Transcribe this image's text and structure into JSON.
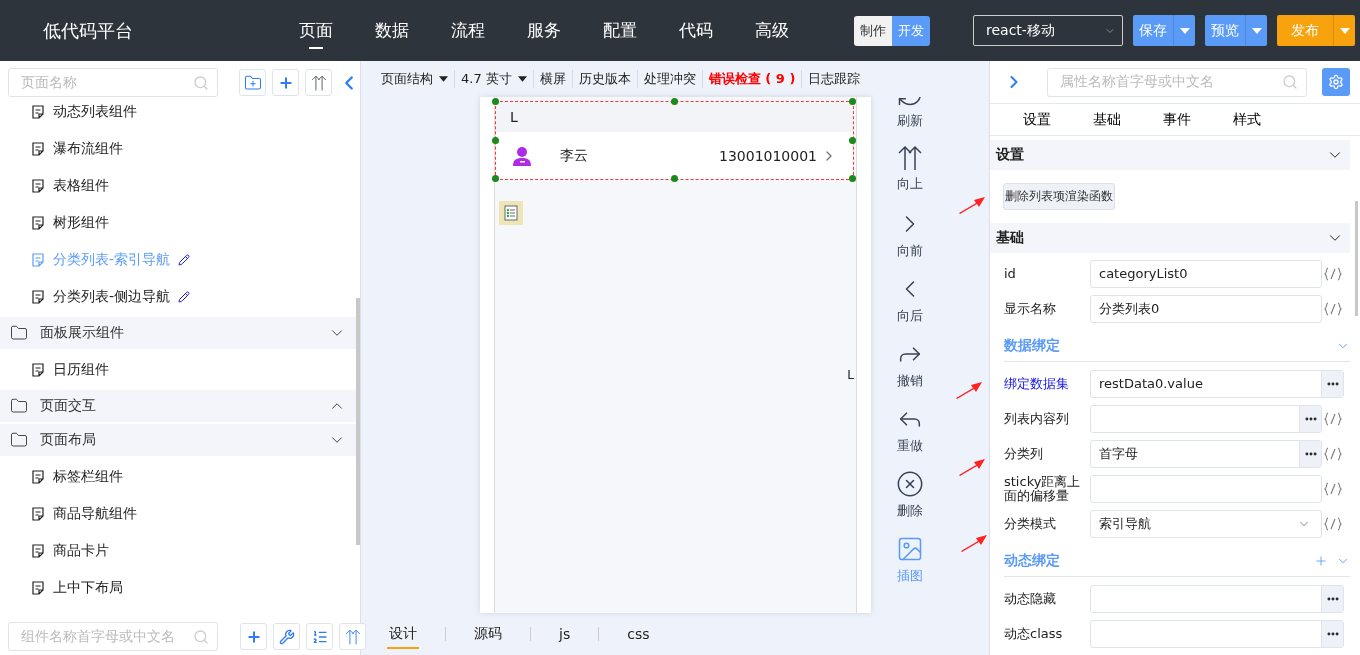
{
  "app": {
    "title": "低代码平台"
  },
  "nav": [
    {
      "label": "页面",
      "selected": true
    },
    {
      "label": "数据",
      "selected": false
    },
    {
      "label": "流程",
      "selected": false
    },
    {
      "label": "服务",
      "selected": false
    },
    {
      "label": "配置",
      "selected": false
    },
    {
      "label": "代码",
      "selected": false
    },
    {
      "label": "高级",
      "selected": false
    }
  ],
  "mode_toggle": [
    {
      "label": "制作",
      "selected": false
    },
    {
      "label": "开发",
      "selected": true
    }
  ],
  "framework_select": {
    "value": "react-移动"
  },
  "actions": [
    {
      "label": "保存",
      "kind": "primary"
    },
    {
      "label": "预览",
      "kind": "primary"
    },
    {
      "label": "发布",
      "kind": "publish"
    }
  ],
  "page_tree": {
    "search": {
      "placeholder": "页面名称"
    },
    "items": [
      {
        "kind": "page",
        "label": "动态列表组件",
        "selected": false,
        "editable": false
      },
      {
        "kind": "page",
        "label": "瀑布流组件",
        "selected": false,
        "editable": false
      },
      {
        "kind": "page",
        "label": "表格组件",
        "selected": false,
        "editable": false
      },
      {
        "kind": "page",
        "label": "树形组件",
        "selected": false,
        "editable": false
      },
      {
        "kind": "page",
        "label": "分类列表-索引导航",
        "selected": true,
        "editable": true
      },
      {
        "kind": "page",
        "label": "分类列表-侧边导航",
        "selected": false,
        "editable": true
      },
      {
        "kind": "group",
        "label": "面板展示组件",
        "expanded": true,
        "children": [
          {
            "kind": "page",
            "label": "日历组件",
            "selected": false,
            "editable": false
          }
        ]
      },
      {
        "kind": "group",
        "label": "页面交互",
        "expanded": false
      },
      {
        "kind": "group",
        "label": "页面布局",
        "expanded": true,
        "children": [
          {
            "kind": "page",
            "label": "标签栏组件",
            "selected": false,
            "editable": false
          },
          {
            "kind": "page",
            "label": "商品导航组件",
            "selected": false,
            "editable": false
          },
          {
            "kind": "page",
            "label": "商品卡片",
            "selected": false,
            "editable": false
          },
          {
            "kind": "page",
            "label": "上中下布局",
            "selected": false,
            "editable": false
          }
        ]
      }
    ]
  },
  "component_search": {
    "placeholder": "组件名称首字母或中文名"
  },
  "canvas_toolbar": [
    {
      "label": "页面结构",
      "kind": "dropdown"
    },
    {
      "label": "4.7 英寸",
      "kind": "dropdown"
    },
    {
      "label": "横屏",
      "kind": "plain"
    },
    {
      "label": "历史版本",
      "kind": "plain"
    },
    {
      "label": "处理冲突",
      "kind": "plain"
    },
    {
      "label": "错误检查 ( 9 )",
      "kind": "error"
    },
    {
      "label": "日志跟踪",
      "kind": "plain"
    }
  ],
  "phone": {
    "group_letter": "L",
    "contact": {
      "name": "李云",
      "phone": "13001010001"
    },
    "index_letters": [
      "L"
    ]
  },
  "tools": [
    {
      "label": "刷新",
      "kind": "refresh",
      "selected": false
    },
    {
      "label": "向上",
      "kind": "up",
      "selected": false
    },
    {
      "label": "向前",
      "kind": "forward",
      "selected": false
    },
    {
      "label": "向后",
      "kind": "back",
      "selected": false
    },
    {
      "label": "撤销",
      "kind": "undo",
      "selected": false
    },
    {
      "label": "重做",
      "kind": "redo",
      "selected": false
    },
    {
      "label": "删除",
      "kind": "delete",
      "selected": false
    },
    {
      "label": "插图",
      "kind": "image",
      "selected": true
    }
  ],
  "editor_tabs": [
    {
      "label": "设计",
      "selected": true
    },
    {
      "label": "源码",
      "selected": false
    },
    {
      "label": "js",
      "selected": false
    },
    {
      "label": "css",
      "selected": false
    }
  ],
  "inspector": {
    "search": {
      "placeholder": "属性名称首字母或中文名"
    },
    "tabs": [
      "设置",
      "基础",
      "事件",
      "样式"
    ],
    "sections": [
      {
        "title": "设置",
        "expanded": true,
        "content": [
          {
            "kind": "button",
            "label": "删除列表项渲染函数"
          }
        ]
      },
      {
        "title": "基础",
        "expanded": true,
        "content": [
          {
            "kind": "field",
            "label": "id",
            "value": "categoryList0",
            "picker": false,
            "code": true,
            "bound": false
          },
          {
            "kind": "field",
            "label": "显示名称",
            "value": "分类列表0",
            "picker": false,
            "code": true,
            "bound": false
          },
          {
            "kind": "group",
            "title": "数据绑定",
            "addable": false,
            "expanded": true
          },
          {
            "kind": "field",
            "label": "绑定数据集",
            "value": "restData0.value",
            "picker": true,
            "code": false,
            "bound": true
          },
          {
            "kind": "field",
            "label": "列表内容列",
            "picker": true,
            "code": true,
            "bound": false
          },
          {
            "kind": "field",
            "label": "分类列",
            "value": "首字母",
            "picker": true,
            "code": true,
            "bound": false
          },
          {
            "kind": "field",
            "label": "sticky距离上面的偏移量",
            "picker": false,
            "code": true,
            "bound": false
          },
          {
            "kind": "select",
            "label": "分类模式",
            "value": "索引导航",
            "picker": false,
            "code": true,
            "bound": false
          },
          {
            "kind": "group",
            "title": "动态绑定",
            "addable": true,
            "expanded": true
          },
          {
            "kind": "field",
            "label": "动态隐藏",
            "picker": true,
            "code": false,
            "bound": false
          },
          {
            "kind": "field",
            "label": "动态class",
            "picker": true,
            "code": false,
            "bound": false
          }
        ]
      }
    ]
  }
}
